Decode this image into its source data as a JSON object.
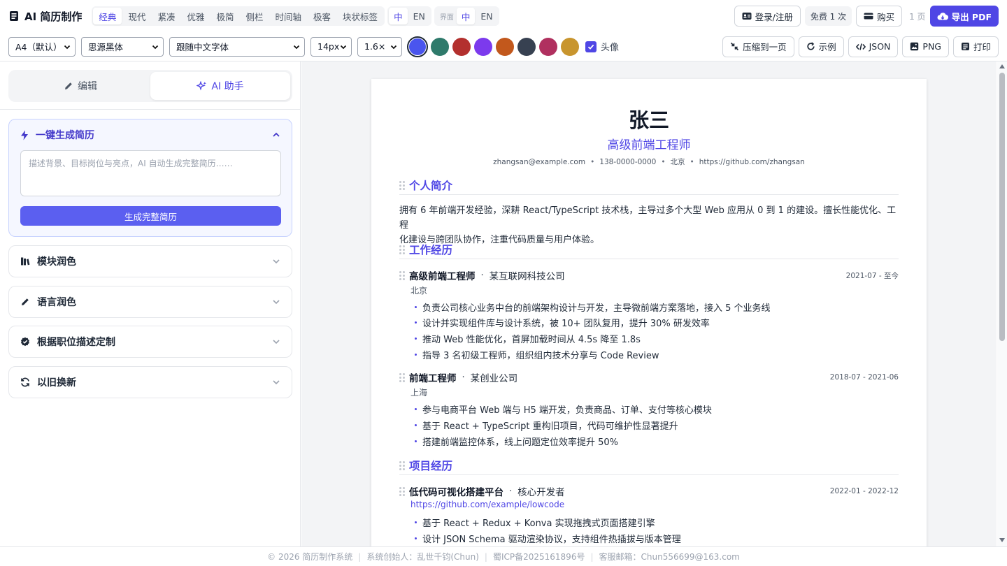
{
  "app": {
    "title": "AI 简历制作"
  },
  "templates": [
    "经典",
    "现代",
    "紧凑",
    "优雅",
    "极简",
    "侧栏",
    "时间轴",
    "极客",
    "块状标签"
  ],
  "active_template": 0,
  "content_lang": {
    "items": [
      "中",
      "EN"
    ],
    "active": 0
  },
  "ui_lang": {
    "label": "界面",
    "items": [
      "中",
      "EN"
    ],
    "active": 0
  },
  "header_right": {
    "login": "登录/注册",
    "free": "免费 1 次",
    "buy": "购买",
    "pages": "1 页",
    "export_pdf": "导出 PDF"
  },
  "toolbar": {
    "paper": "A4（默认）",
    "font": "思源黑体",
    "en_font": "跟随中文字体",
    "size": "14px",
    "line_height": "1.6×",
    "colors": [
      "#4a55ee",
      "#2f7a6b",
      "#b3302e",
      "#7c3aed",
      "#c2581c",
      "#374151",
      "#b0305f",
      "#c8952e"
    ],
    "active_color": 0,
    "avatar_label": "头像",
    "avatar_checked": true,
    "compress": "压缩到一页",
    "example": "示例",
    "json": "JSON",
    "png": "PNG",
    "print": "打印"
  },
  "left": {
    "tabs": [
      "编辑",
      "AI 助手"
    ],
    "active_tab": 1,
    "generate": {
      "title": "一键生成简历",
      "placeholder": "描述背景、目标岗位与亮点，AI 自动生成完整简历……",
      "button": "生成完整简历"
    },
    "cards": [
      "模块润色",
      "语言润色",
      "根据职位描述定制",
      "以旧换新"
    ]
  },
  "resume": {
    "name": "张三",
    "role": "高级前端工程师",
    "contact": [
      "zhangsan@example.com",
      "138-0000-0000",
      "北京",
      "https://github.com/zhangsan"
    ],
    "sections": {
      "summary": "个人简介",
      "work": "工作经历",
      "projects": "项目经历"
    },
    "summary_lines": [
      "拥有 6 年前端开发经验，深耕 React/TypeScript 技术栈，主导过多个大型 Web 应用从 0 到 1 的建设。擅长性能优化、工程",
      "化建设与跨团队协作，注重代码质量与用户体验。"
    ],
    "jobs": [
      {
        "title": "高级前端工程师",
        "company": "某互联网科技公司",
        "date": "2021-07 - 至今",
        "location": "北京",
        "bullets": [
          "负责公司核心业务中台的前端架构设计与开发，主导微前端方案落地，接入 5 个业务线",
          "设计并实现组件库与设计系统，被 10+ 团队复用，提升 30% 研发效率",
          "推动 Web 性能优化，首屏加载时间从 4.5s 降至 1.8s",
          "指导 3 名初级工程师，组织组内技术分享与 Code Review"
        ]
      },
      {
        "title": "前端工程师",
        "company": "某创业公司",
        "date": "2018-07 - 2021-06",
        "location": "上海",
        "bullets": [
          "参与电商平台 Web 端与 H5 端开发，负责商品、订单、支付等核心模块",
          "基于 React + TypeScript 重构旧项目，代码可维护性显著提升",
          "搭建前端监控体系，线上问题定位效率提升 50%"
        ]
      }
    ],
    "project": {
      "title": "低代码可视化搭建平台",
      "role": "核心开发者",
      "date": "2022-01 - 2022-12",
      "link": "https://github.com/example/lowcode",
      "bullets": [
        "基于 React + Redux + Konva 实现拖拽式页面搭建引擎",
        "设计 JSON Schema 驱动渲染协议，支持组件热插拔与版本管理"
      ]
    }
  },
  "footer": [
    "© 2026 简历制作系统",
    "系统创始人：乱世千钧(Chun)",
    "蜀ICP备2025161896号",
    "客服邮箱：Chun556699@163.com"
  ]
}
